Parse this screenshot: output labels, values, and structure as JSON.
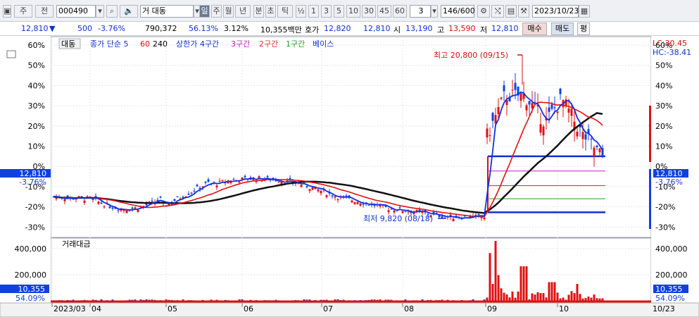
{
  "toolbar": {
    "btn_ju": "주",
    "btn_jeon": "전",
    "code": "000490",
    "market": "거 대동",
    "periods": [
      "일",
      "주",
      "월",
      "년",
      "분",
      "초",
      "틱"
    ],
    "active_period": "일",
    "half": "½",
    "intervals": [
      "1",
      "3",
      "5",
      "10",
      "30",
      "45",
      "60"
    ],
    "multiplier": "3",
    "count": "146/600",
    "date": "2023/10/23"
  },
  "info": {
    "price": "12,810",
    "change_arrow": "▼",
    "change": "500",
    "change_pct": "-3.76%",
    "volume": "790,372",
    "vol_ratio": "56.13%",
    "turnover": "3.12%",
    "amount": "10,355백만",
    "quote_label": "호가",
    "ask": "12,820",
    "bid": "12,810",
    "open_label": "시",
    "open": "13,190",
    "high_label": "고",
    "high": "13,590",
    "low_label": "저",
    "low": "12,810",
    "buy": "매수",
    "sell": "매도",
    "eval": "평"
  },
  "legend": {
    "name": "대동",
    "close_sma": "종가 단순 5",
    "ma60": "60",
    "ma240": "240",
    "upper4": "상한가 4구간",
    "band3": "3구간",
    "band2": "2구간",
    "band1": "1구간",
    "base": "베이스"
  },
  "right_top": {
    "lc": "LC:30.45",
    "hc": "HC:-38.41"
  },
  "annotations": {
    "high": "최고 20,800 (09/15)",
    "low": "최저 9,820 (08/18)"
  },
  "price_axis": {
    "left": [
      "60%",
      "50%",
      "40%",
      "30%",
      "20%",
      "10%",
      "0%",
      "-10%",
      "-20%",
      "-30%"
    ],
    "right": [
      "60%",
      "50%",
      "40%",
      "30%",
      "20%",
      "10%",
      "0%",
      "-10%",
      "-20%",
      "-30%"
    ],
    "current_price": "12,810",
    "current_pct": "-3.76%"
  },
  "volume_panel": {
    "title": "거래대금",
    "axis": [
      "400,000",
      "200,000"
    ],
    "current": "10,355",
    "current_pct": "54.09%"
  },
  "x_axis": [
    "2023/03",
    "04",
    "05",
    "06",
    "07",
    "08",
    "09",
    "10"
  ],
  "x_axis_right": "10/23",
  "colors": {
    "up": "#e01010",
    "down": "#1040e0",
    "bg": "#ffffff",
    "ma240": "#111111",
    "ma60": "#e01010",
    "sma5": "#1030e0"
  }
}
